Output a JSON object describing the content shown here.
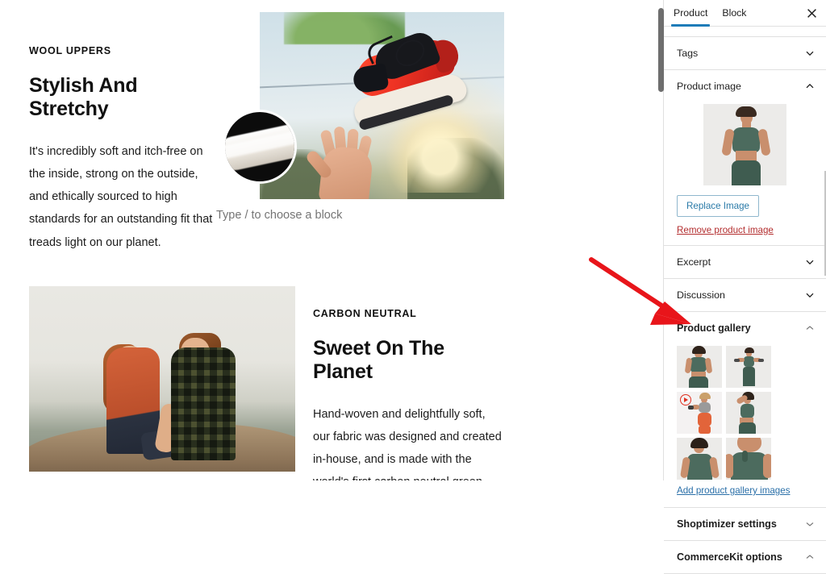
{
  "editor": {
    "sections": [
      {
        "eyebrow": "WOOL UPPERS",
        "heading": "Stylish And Stretchy",
        "body": "It's incredibly soft and itch-free on the inside, strong on the outside, and ethically sourced to high standards for an outstanding fit that treads light on our planet.",
        "image_alt": "red-and-black-sneaker-tossed-in-air-above-open-hand",
        "inset_alt": "wool-fiber-closeup-circle"
      },
      {
        "eyebrow": "CARBON NEUTRAL",
        "heading": "Sweet On The Planet",
        "body": "Hand-woven and delightfully soft, our fabric was designed and created in-house, and is made with the world's first carbon neutral green EVA.",
        "image_alt": "couple-sitting-on-rock-overlooking-misty-valley"
      }
    ],
    "block_placeholder": "Type / to choose a block"
  },
  "sidebar": {
    "tabs": [
      {
        "label": "Product",
        "active": true
      },
      {
        "label": "Block",
        "active": false
      }
    ],
    "close_label": "Close settings",
    "panels": [
      {
        "id": "tags",
        "title": "Tags",
        "expanded": false
      },
      {
        "id": "product-image",
        "title": "Product image",
        "expanded": true
      },
      {
        "id": "excerpt",
        "title": "Excerpt",
        "expanded": false
      },
      {
        "id": "discussion",
        "title": "Discussion",
        "expanded": false
      },
      {
        "id": "product-gallery",
        "title": "Product gallery",
        "expanded": true
      },
      {
        "id": "shoptimizer-settings",
        "title": "Shoptimizer settings",
        "expanded": false
      },
      {
        "id": "commercekit-options",
        "title": "CommerceKit options",
        "expanded": true
      }
    ],
    "product_image": {
      "thumbnail_alt": "woman-in-green-sports-bra-and-leggings-hands-on-hips",
      "replace_label": "Replace Image",
      "remove_label": "Remove product image"
    },
    "product_gallery": {
      "add_label": "Add product gallery images",
      "items": [
        {
          "alt": "back-view-green-sports-bra",
          "video": false
        },
        {
          "alt": "full-body-holding-dumbbells",
          "video": false
        },
        {
          "alt": "side-view-orange-leggings-dumbbell",
          "video": true
        },
        {
          "alt": "side-profile-arm-raised",
          "video": false
        },
        {
          "alt": "shoulder-closeup-over-shoulder-look",
          "video": false
        },
        {
          "alt": "chest-detail-racerback-strap",
          "video": false
        }
      ]
    }
  },
  "annotation": {
    "arrow_color": "#e8151a",
    "arrow_from": "733,322",
    "arrow_to": "853,401"
  },
  "colors": {
    "accent_blue": "#1e7cb8",
    "link_blue": "#2a6fa8",
    "danger_red": "#b32d2e",
    "arrow_red": "#e8151a",
    "border": "#e0e0e0",
    "text": "#1e1e1e"
  }
}
